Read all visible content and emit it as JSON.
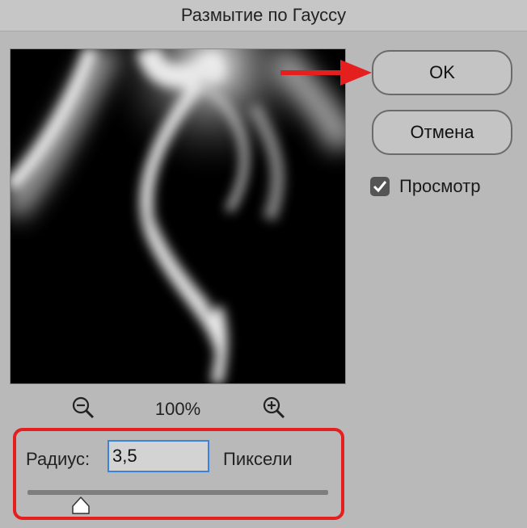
{
  "dialog": {
    "title": "Размытие по Гауссу"
  },
  "buttons": {
    "ok_label": "OK",
    "cancel_label": "Отмена"
  },
  "preview": {
    "label": "Просмотр",
    "checked": true
  },
  "zoom": {
    "level": "100%"
  },
  "radius": {
    "label": "Радиус:",
    "value": "3,5",
    "units": "Пиксели",
    "slider_fraction": 0.18
  },
  "colors": {
    "highlight": "#e51e1e",
    "input_focus": "#3c82d8"
  },
  "icons": [
    "zoom-out-icon",
    "zoom-in-icon",
    "checkmark-icon",
    "arrow-icon",
    "slider-thumb-icon"
  ]
}
